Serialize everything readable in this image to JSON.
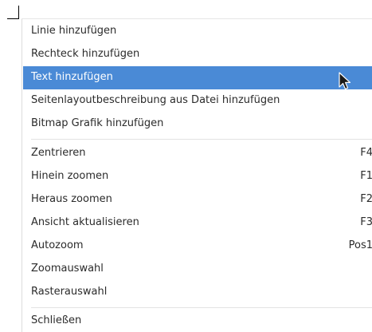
{
  "menu": {
    "group1": [
      {
        "label": "Linie hinzufügen"
      },
      {
        "label": "Rechteck hinzufügen"
      },
      {
        "label": "Text hinzufügen",
        "highlighted": true
      },
      {
        "label": "Seitenlayoutbeschreibung aus Datei hinzufügen"
      },
      {
        "label": "Bitmap Grafik hinzufügen"
      }
    ],
    "group2": [
      {
        "label": "Zentrieren",
        "shortcut": "F4"
      },
      {
        "label": "Hinein zoomen",
        "shortcut": "F1"
      },
      {
        "label": "Heraus zoomen",
        "shortcut": "F2"
      },
      {
        "label": "Ansicht aktualisieren",
        "shortcut": "F3"
      },
      {
        "label": "Autozoom",
        "shortcut": "Pos1"
      },
      {
        "label": "Zoomauswahl"
      },
      {
        "label": "Rasterauswahl"
      }
    ],
    "group3": [
      {
        "label": "Schließen"
      }
    ]
  },
  "colors": {
    "highlight": "#4a8ad6",
    "text": "#2b2b2b",
    "separator": "#e3e3e3"
  },
  "icons": {
    "cursor": "mouse-pointer-icon",
    "crosshair": "crosshair-corner-icon"
  }
}
